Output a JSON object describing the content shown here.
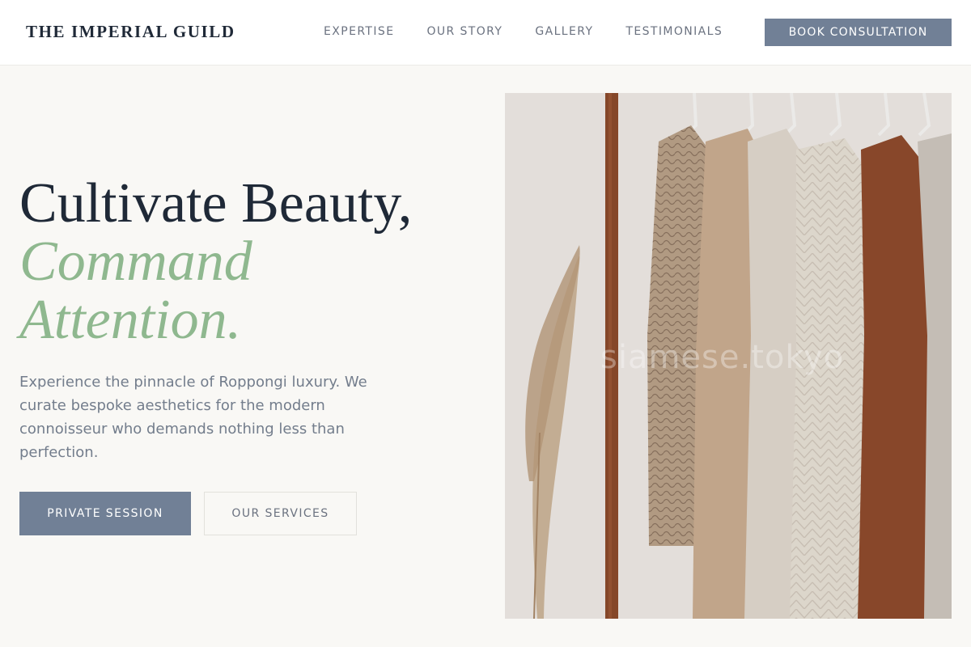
{
  "brand": "THE IMPERIAL GUILD",
  "nav": {
    "items": [
      "EXPERTISE",
      "OUR STORY",
      "GALLERY",
      "TESTIMONIALS"
    ],
    "cta": "BOOK CONSULTATION"
  },
  "hero": {
    "title_line1": "Cultivate Beauty,",
    "title_line2": "Command",
    "title_line3": "Attention.",
    "description": "Experience the pinnacle of Roppongi luxury. We curate bespoke aesthetics for the modern connoisseur who demands nothing less than perfection.",
    "primary_button": "PRIVATE SESSION",
    "secondary_button": "OUR SERVICES",
    "image_watermark": "siamese.tokyo"
  },
  "colors": {
    "accent": "#8fb88f",
    "button": "#718096",
    "text_dark": "#1f2937",
    "background": "#f9f8f5"
  }
}
